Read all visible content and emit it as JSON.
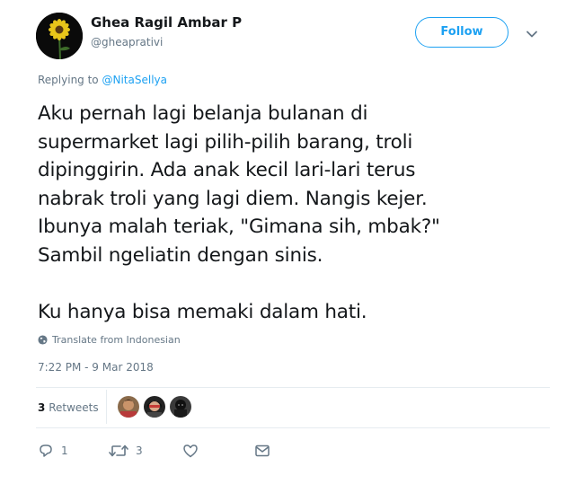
{
  "author": {
    "name": "Ghea Ragil Ambar P",
    "handle": "@gheaprativi"
  },
  "follow_label": "Follow",
  "replying": {
    "prefix": "Replying to",
    "mention": "@NitaSellya"
  },
  "tweet_text": "Aku pernah lagi belanja bulanan di\nsupermarket lagi pilih-pilih barang, troli\ndipinggirin. Ada anak kecil lari-lari terus\nnabrak troli yang lagi diem. Nangis kejer.\nIbunya malah teriak, \"Gimana sih, mbak?\"\nSambil ngeliatin dengan sinis.\n\nKu hanya bisa memaki dalam hati.",
  "translate_label": "Translate from Indonesian",
  "timestamp": "7:22 PM - 9 Mar 2018",
  "stats": {
    "retweets_count": "3",
    "retweets_label": "Retweets"
  },
  "actions": {
    "reply_count": "1",
    "retweet_count": "3"
  },
  "icons": {
    "avatar": "sunflower-avatar",
    "caret": "chevron-down-icon",
    "globe": "globe-icon",
    "reply": "reply-icon",
    "retweet": "retweet-icon",
    "like": "heart-icon",
    "message": "envelope-icon"
  },
  "colors": {
    "accent": "#1da1f2",
    "secondary_text": "#657786",
    "primary_text": "#14171a",
    "divider": "#e6ecf0"
  }
}
